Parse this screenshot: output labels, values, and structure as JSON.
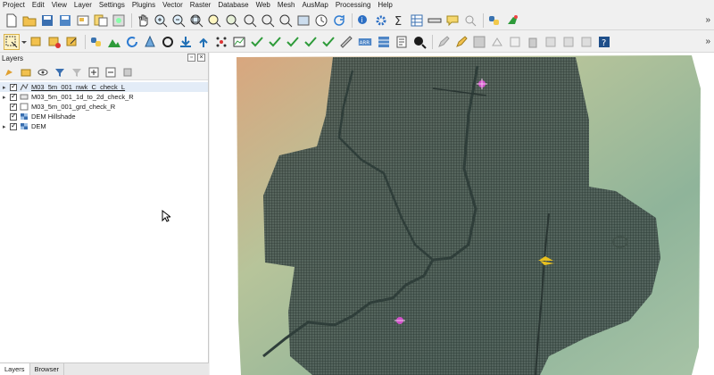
{
  "menu": [
    "Project",
    "Edit",
    "View",
    "Layer",
    "Settings",
    "Plugins",
    "Vector",
    "Raster",
    "Database",
    "Web",
    "Mesh",
    "AusMap",
    "Processing",
    "Help"
  ],
  "toolbar": {
    "overflow": "»"
  },
  "panel": {
    "title": "Layers",
    "tools": [
      "open-layer-styling-icon",
      "add-group-icon",
      "manage-visibility-icon",
      "filter-legend-icon",
      "filter-expression-icon",
      "expand-all-icon",
      "collapse-all-icon",
      "remove-layer-icon"
    ],
    "layers": [
      {
        "label": "M03_5m_001_nwk_C_check_L",
        "type": "line",
        "checked": true,
        "selected": true
      },
      {
        "label": "M03_5m_001_1d_to_2d_check_R",
        "type": "polygon",
        "checked": true,
        "selected": false
      },
      {
        "label": "M03_5m_001_grd_check_R",
        "type": "polygon-empty",
        "checked": true,
        "selected": false
      },
      {
        "label": "DEM Hillshade",
        "type": "raster",
        "checked": true,
        "selected": false
      },
      {
        "label": "DEM",
        "type": "raster",
        "checked": true,
        "selected": false
      }
    ]
  },
  "tabs": [
    "Layers",
    "Browser"
  ],
  "colors": {
    "grid_fill": "#4a5a55",
    "grid_line": "#1e2b28",
    "point_pink": "#d050c8",
    "point_yellow": "#e8c020",
    "dem_low": "#8fb49a",
    "dem_high": "#d9a67e"
  }
}
